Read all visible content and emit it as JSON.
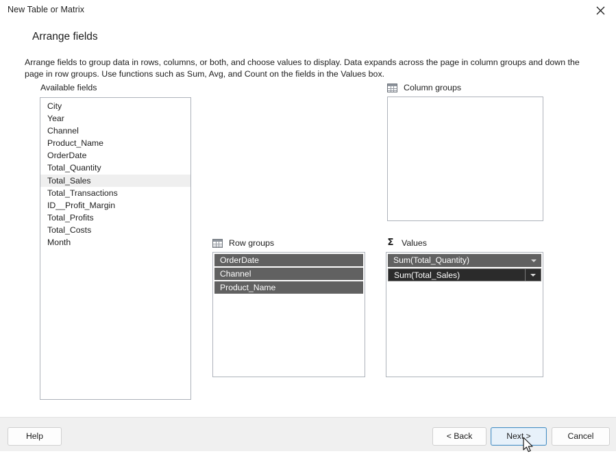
{
  "window": {
    "title": "New Table or Matrix",
    "close_icon": "close-icon"
  },
  "page": {
    "heading": "Arrange fields",
    "description": "Arrange fields to group data in rows, columns, or both, and choose values to display. Data expands across the page in column groups and down the page in row groups.  Use functions such as Sum, Avg, and Count on the fields in the Values box."
  },
  "available_fields": {
    "label": "Available fields",
    "items": [
      {
        "name": "City",
        "highlighted": false
      },
      {
        "name": "Year",
        "highlighted": false
      },
      {
        "name": "Channel",
        "highlighted": false
      },
      {
        "name": "Product_Name",
        "highlighted": false
      },
      {
        "name": "OrderDate",
        "highlighted": false
      },
      {
        "name": "Total_Quantity",
        "highlighted": false
      },
      {
        "name": "Total_Sales",
        "highlighted": true
      },
      {
        "name": "Total_Transactions",
        "highlighted": false
      },
      {
        "name": "ID__Profit_Margin",
        "highlighted": false
      },
      {
        "name": "Total_Profits",
        "highlighted": false
      },
      {
        "name": "Total_Costs",
        "highlighted": false
      },
      {
        "name": "Month",
        "highlighted": false
      }
    ]
  },
  "column_groups": {
    "label": "Column groups",
    "icon": "grid-icon",
    "items": []
  },
  "row_groups": {
    "label": "Row groups",
    "icon": "grid-icon",
    "items": [
      {
        "name": "OrderDate"
      },
      {
        "name": "Channel"
      },
      {
        "name": "Product_Name"
      }
    ]
  },
  "values": {
    "label": "Values",
    "icon": "sigma-icon",
    "items": [
      {
        "name": "Sum(Total_Quantity)",
        "selected": false
      },
      {
        "name": "Sum(Total_Sales)",
        "selected": true
      }
    ]
  },
  "footer": {
    "help_label": "Help",
    "back_label": "< Back",
    "next_label": "Next >",
    "cancel_label": "Cancel"
  },
  "colors": {
    "pill_background": "#616161",
    "pill_selected_background": "#2b2b2b",
    "focus_border": "#4a90c4",
    "focus_fill": "#e7f1fa",
    "highlight_row": "#efefef",
    "footer_background": "#f0f0f0"
  }
}
